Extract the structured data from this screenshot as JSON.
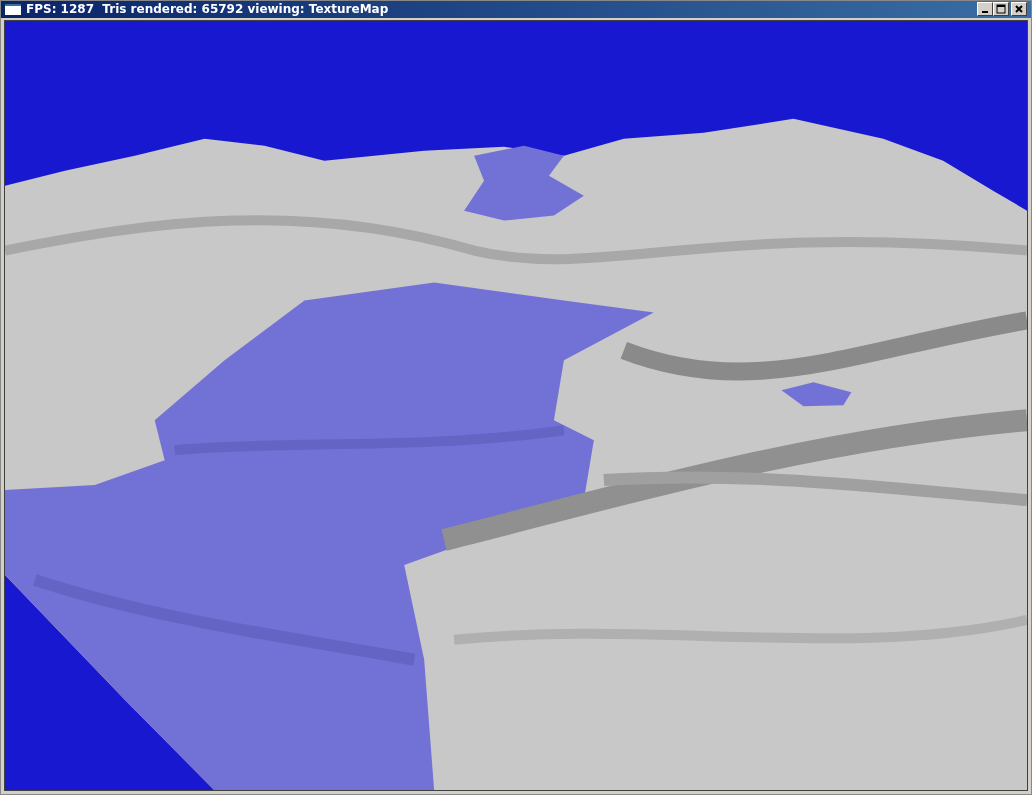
{
  "window": {
    "title": "FPS: 1287  Tris rendered: 65792 viewing: TextureMap"
  }
}
